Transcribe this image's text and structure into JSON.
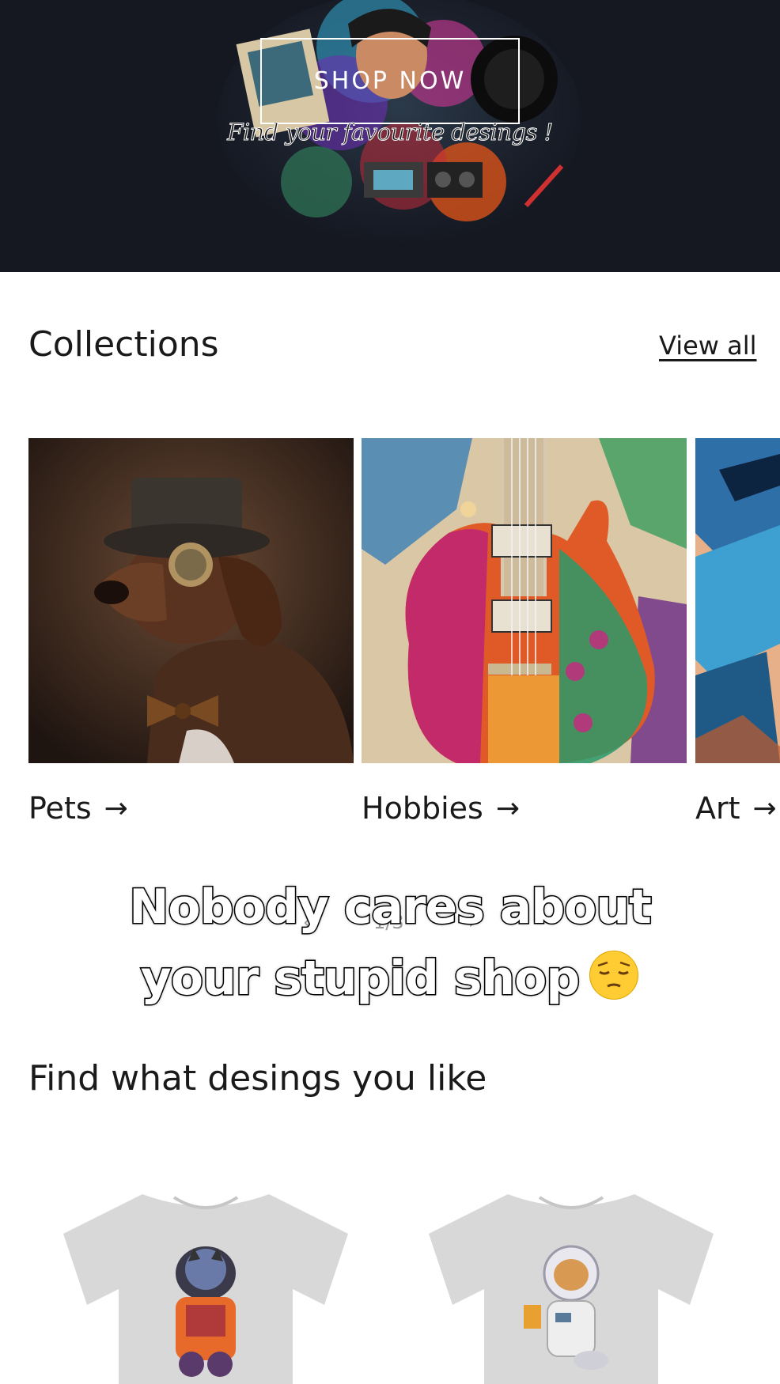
{
  "hero": {
    "button_label": "SHOP NOW",
    "tagline": "Find your favourite desings !"
  },
  "collections": {
    "title": "Collections",
    "view_all": "View all",
    "items": [
      {
        "label": "Pets",
        "arrow": "→"
      },
      {
        "label": "Hobbies",
        "arrow": "→"
      },
      {
        "label": "Art",
        "arrow": "→"
      }
    ]
  },
  "slider": {
    "prev": "‹",
    "counter": "1/3",
    "next": "›"
  },
  "overlay": {
    "line1": "Nobody cares about",
    "line2": "your stupid shop"
  },
  "designs": {
    "title": "Find what desings you like"
  },
  "colors": {
    "hero_bg": "#151821",
    "text": "#1a1a1a",
    "tshirt": "#d8d8d8"
  }
}
